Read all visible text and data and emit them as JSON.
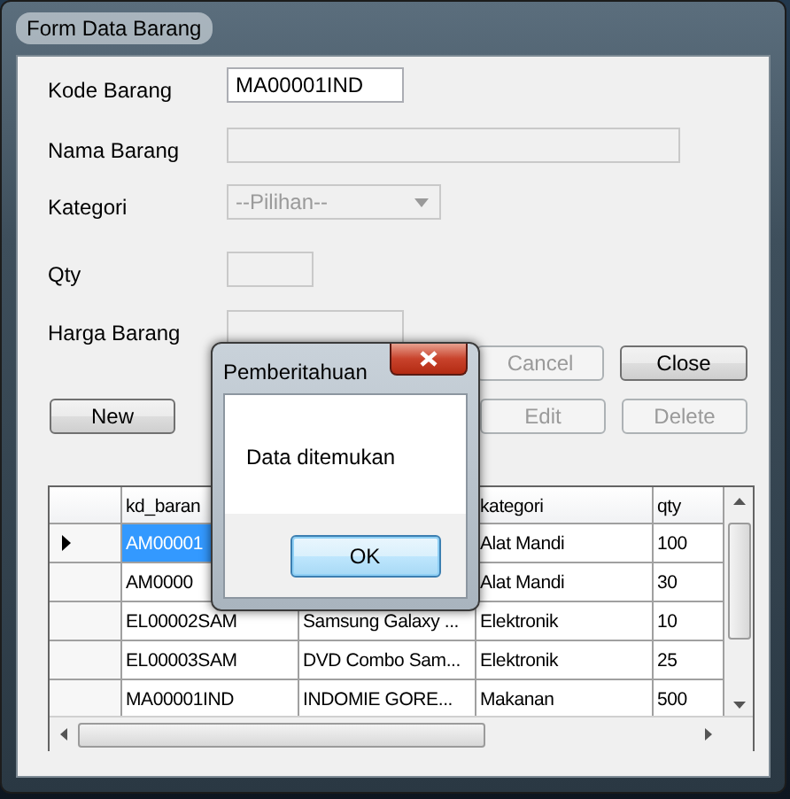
{
  "window": {
    "title": "Form Data Barang"
  },
  "fields": [
    {
      "label": "Kode Barang",
      "kind": "text",
      "value": "MA00001IND",
      "disabled": false
    },
    {
      "label": "Nama Barang",
      "kind": "text",
      "disabled": true
    },
    {
      "label": "Kategori",
      "kind": "combo",
      "value": "--Pilihan--",
      "disabled": true
    },
    {
      "label": "Qty",
      "kind": "text",
      "disabled": true
    },
    {
      "label": "Harga Barang",
      "kind": "text",
      "disabled": true
    }
  ],
  "buttons_top": [
    {
      "label": "Cancel",
      "disabled": true
    },
    {
      "label": "Close",
      "disabled": false
    }
  ],
  "buttons_bottom": [
    {
      "label": "New",
      "disabled": false
    },
    {
      "label": "Edit",
      "disabled": true
    },
    {
      "label": "Delete",
      "disabled": true
    }
  ],
  "grid": {
    "columns": [
      "kd_baran",
      "kategori",
      "qty"
    ],
    "rows": [
      {
        "kd_barang": "AM00001",
        "kategori": "Alat Mandi",
        "qty": "100",
        "selected": true
      },
      {
        "kd_barang": "AM0000",
        "kategori": "Alat Mandi",
        "qty": "30",
        "selected": false
      },
      {
        "kd_barang": "EL00002SAM",
        "nama_barang": "Samsung Galaxy ...",
        "kategori": "Elektronik",
        "qty": "10",
        "selected": false
      },
      {
        "kd_barang": "EL00003SAM",
        "nama_barang": "DVD Combo Sam...",
        "kategori": "Elektronik",
        "qty": "25",
        "selected": false
      },
      {
        "kd_barang": "MA00001IND",
        "nama_barang": "INDOMIE GORE...",
        "kategori": "Makanan",
        "qty": "500",
        "selected": false
      }
    ]
  },
  "dialog": {
    "title": "Pemberitahuan",
    "message": "Data ditemukan",
    "button": "OK"
  }
}
